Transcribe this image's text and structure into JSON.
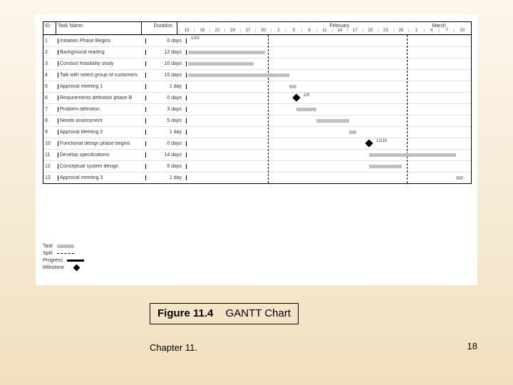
{
  "caption_label": "Figure 11.4",
  "caption_title": "GANTT Chart",
  "footer_left": "Chapter 11.",
  "footer_right": "18",
  "header": {
    "id": "ID",
    "task": "Task Name",
    "duration": "Duration",
    "months": [
      "February",
      "March"
    ],
    "days": [
      "15",
      "18",
      "21",
      "24",
      "27",
      "30",
      "2",
      "5",
      "8",
      "11",
      "14",
      "17",
      "20",
      "23",
      "26",
      "1",
      "4",
      "7",
      "10"
    ]
  },
  "legend": {
    "task": "Task",
    "split": "Split",
    "progress": "Progress",
    "milestone": "Milestone"
  },
  "rows": [
    {
      "id": "1",
      "name": "Initiation Phase Begins",
      "dur": "0 days"
    },
    {
      "id": "2",
      "name": "Background reading",
      "dur": "12 days"
    },
    {
      "id": "3",
      "name": "Conduct feasibility study",
      "dur": "10 days"
    },
    {
      "id": "4",
      "name": "Talk with select group of customers",
      "dur": "15 days"
    },
    {
      "id": "5",
      "name": "Approval meeting 1",
      "dur": "1 day"
    },
    {
      "id": "6",
      "name": "Requirements definition phase B",
      "dur": "0 days"
    },
    {
      "id": "7",
      "name": "Problem definition",
      "dur": "3 days"
    },
    {
      "id": "8",
      "name": "Needs assessment",
      "dur": "5 days"
    },
    {
      "id": "9",
      "name": "Approval Meeting 2",
      "dur": "1 day"
    },
    {
      "id": "10",
      "name": "Functional design phase begins",
      "dur": "0 days"
    },
    {
      "id": "11",
      "name": "Develop specifications",
      "dur": "14 days"
    },
    {
      "id": "12",
      "name": "Conceptual system design",
      "dur": "5 days"
    },
    {
      "id": "13",
      "name": "Approval meeting 3",
      "dur": "1 day"
    }
  ],
  "row_labels": {
    "r1": "1/15",
    "r6": "2/5",
    "r10": "12/20"
  },
  "chart_data": {
    "type": "gantt",
    "title": "Figure 11.4  GANTT Chart",
    "x_unit": "date",
    "x_ticks": [
      "Jan 15",
      "Jan 18",
      "Jan 21",
      "Jan 24",
      "Jan 27",
      "Jan 30",
      "Feb 2",
      "Feb 5",
      "Feb 8",
      "Feb 11",
      "Feb 14",
      "Feb 17",
      "Feb 20",
      "Feb 23",
      "Feb 26",
      "Mar 1",
      "Mar 4",
      "Mar 7",
      "Mar 10"
    ],
    "month_dividers": [
      "Feb 1",
      "Mar 1"
    ],
    "tasks": [
      {
        "id": 1,
        "name": "Initiation Phase Begins",
        "duration_days": 0,
        "type": "milestone",
        "date": "Jan 15",
        "label": "1/15"
      },
      {
        "id": 2,
        "name": "Background reading",
        "duration_days": 12,
        "type": "task",
        "start": "Jan 15",
        "end": "Jan 30"
      },
      {
        "id": 3,
        "name": "Conduct feasibility study",
        "duration_days": 10,
        "type": "task",
        "start": "Jan 15",
        "end": "Jan 28"
      },
      {
        "id": 4,
        "name": "Talk with select group of customers",
        "duration_days": 15,
        "type": "task",
        "start": "Jan 15",
        "end": "Feb 4"
      },
      {
        "id": 5,
        "name": "Approval meeting 1",
        "duration_days": 1,
        "type": "task",
        "start": "Feb 4",
        "end": "Feb 5",
        "depends_on": [
          2,
          3,
          4
        ]
      },
      {
        "id": 6,
        "name": "Requirements definition phase B",
        "duration_days": 0,
        "type": "milestone",
        "date": "Feb 5",
        "label": "2/5",
        "depends_on": [
          5
        ]
      },
      {
        "id": 7,
        "name": "Problem definition",
        "duration_days": 3,
        "type": "task",
        "start": "Feb 5",
        "end": "Feb 9",
        "depends_on": [
          6
        ]
      },
      {
        "id": 8,
        "name": "Needs assessment",
        "duration_days": 5,
        "type": "task",
        "start": "Feb 9",
        "end": "Feb 16",
        "depends_on": [
          7
        ]
      },
      {
        "id": 9,
        "name": "Approval Meeting 2",
        "duration_days": 1,
        "type": "task",
        "start": "Feb 16",
        "end": "Feb 17",
        "depends_on": [
          8
        ]
      },
      {
        "id": 10,
        "name": "Functional design phase begins",
        "duration_days": 0,
        "type": "milestone",
        "date": "Feb 20",
        "label": "12/20",
        "depends_on": [
          9
        ]
      },
      {
        "id": 11,
        "name": "Develop specifications",
        "duration_days": 14,
        "type": "task",
        "start": "Feb 20",
        "end": "Mar 9",
        "depends_on": [
          10
        ]
      },
      {
        "id": 12,
        "name": "Conceptual system design",
        "duration_days": 5,
        "type": "task",
        "start": "Feb 20",
        "end": "Feb 26",
        "depends_on": [
          10
        ]
      },
      {
        "id": 13,
        "name": "Approval meeting 3",
        "duration_days": 1,
        "type": "task",
        "start": "Mar 9",
        "end": "Mar 10",
        "depends_on": [
          11,
          12
        ]
      }
    ],
    "legend": [
      "Task",
      "Split",
      "Progress",
      "Milestone"
    ]
  }
}
